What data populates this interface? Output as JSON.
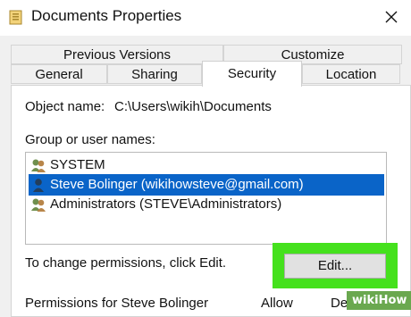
{
  "window": {
    "title": "Documents Properties",
    "icon": "folder-icon",
    "close_icon": "close-icon"
  },
  "tabs": {
    "row1": [
      "Previous Versions",
      "Customize"
    ],
    "row2": [
      "General",
      "Sharing",
      "Security",
      "Location"
    ],
    "active": "Security"
  },
  "security": {
    "object_name_label": "Object name:",
    "object_name_value": "C:\\Users\\wikih\\Documents",
    "group_label": "Group or user names:",
    "users": [
      {
        "name": "SYSTEM",
        "icon": "users-group-icon",
        "selected": false
      },
      {
        "name": "Steve Bolinger (wikihowsteve@gmail.com)",
        "icon": "user-icon",
        "selected": true
      },
      {
        "name": "Administrators (STEVE\\Administrators)",
        "icon": "users-group-icon",
        "selected": false
      }
    ],
    "change_text": "To change permissions, click Edit.",
    "edit_button": "Edit...",
    "permissions_label": "Permissions for Steve Bolinger",
    "allow_header": "Allow",
    "deny_header": "Deny"
  },
  "colors": {
    "selection": "#0a64c8",
    "highlight": "#45e11d"
  },
  "watermark": "wikiHow"
}
